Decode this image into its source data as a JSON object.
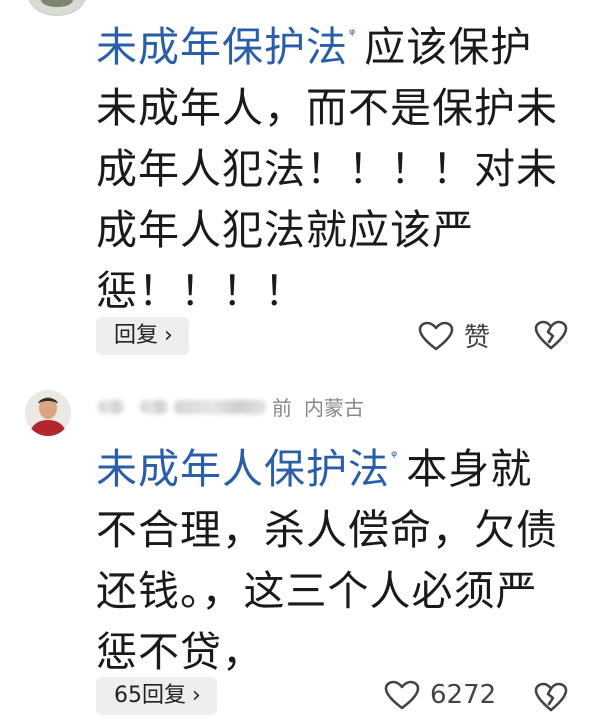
{
  "comments": [
    {
      "link_text": "未成年保护法",
      "body_lines": [
        "应该保护",
        "未成年人，而不是保护未",
        "成年人犯法！！！！对未",
        "成年人犯法就应该严",
        "惩！！！！"
      ],
      "reply_label": "回复",
      "like_label": "赞"
    },
    {
      "time_text": "前",
      "region": "内蒙古",
      "link_text": "未成年人保护法",
      "body_lines": [
        "本身就",
        "不合理，杀人偿命，欠债",
        "还钱。，这三个人必须严",
        "惩不贷，"
      ],
      "reply_label": "65回复",
      "like_label": "6272"
    }
  ],
  "icons": {
    "link": "search-link-icon",
    "reply_chevron": "chevron-right-icon",
    "like": "heart-icon",
    "dislike": "broken-heart-icon"
  },
  "colors": {
    "link": "#2a5ea8",
    "reply_bg": "#eeeeee",
    "meta": "#888888"
  }
}
